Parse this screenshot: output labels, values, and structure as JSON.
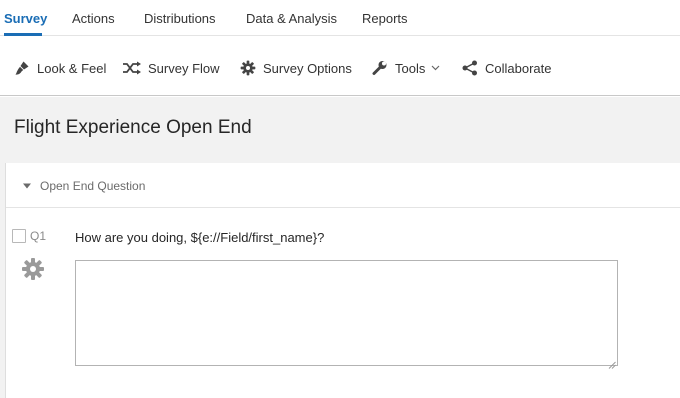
{
  "top_tabs": [
    {
      "label": "Survey",
      "active": true
    },
    {
      "label": "Actions",
      "active": false
    },
    {
      "label": "Distributions",
      "active": false
    },
    {
      "label": "Data & Analysis",
      "active": false
    },
    {
      "label": "Reports",
      "active": false
    }
  ],
  "toolbar": {
    "look_feel": {
      "label": "Look & Feel",
      "icon": "paintbrush-icon"
    },
    "survey_flow": {
      "label": "Survey Flow",
      "icon": "shuffle-icon"
    },
    "survey_options": {
      "label": "Survey Options",
      "icon": "gear-icon"
    },
    "tools": {
      "label": "Tools",
      "icon": "wrench-icon"
    },
    "collaborate": {
      "label": "Collaborate",
      "icon": "share-icon"
    }
  },
  "survey": {
    "title": "Flight Experience Open End",
    "block_title": "Open End Question",
    "question": {
      "number": "Q1",
      "text": "How are you doing, ${e://Field/first_name}?",
      "answer": ""
    }
  },
  "colors": {
    "accent": "#1a6db5",
    "background": "#f2f2f2",
    "text": "#262626"
  }
}
